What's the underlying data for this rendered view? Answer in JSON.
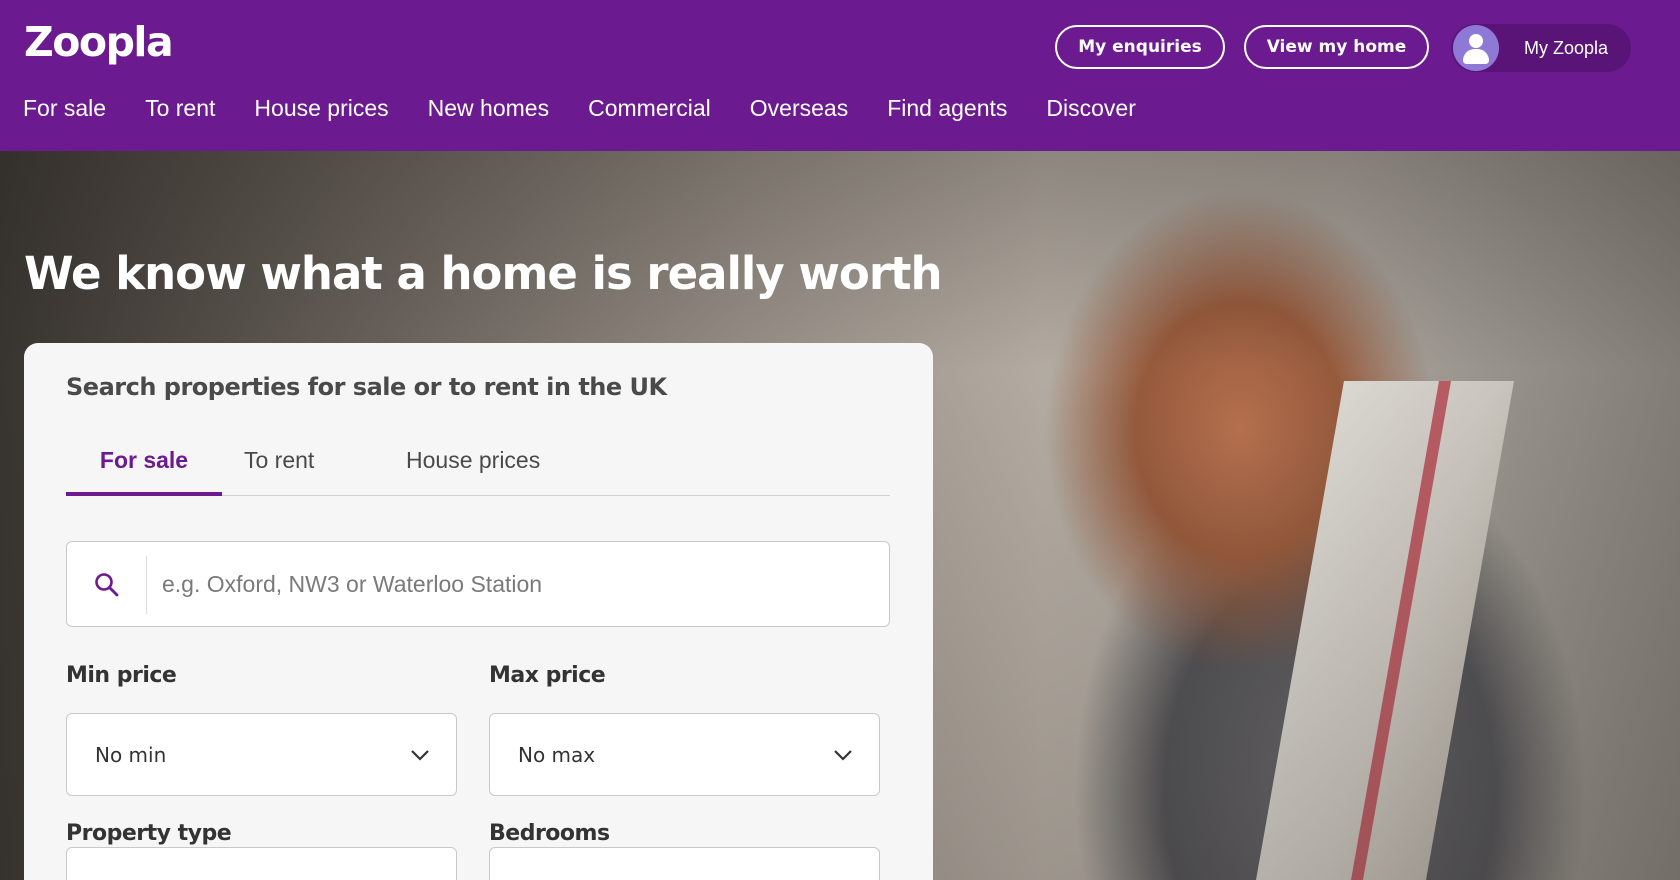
{
  "header": {
    "logo": "Zoopla",
    "my_enquiries": "My enquiries",
    "view_my_home": "View my home",
    "my_zoopla": "My Zoopla",
    "nav": [
      "For sale",
      "To rent",
      "House prices",
      "New homes",
      "Commercial",
      "Overseas",
      "Find agents",
      "Discover"
    ],
    "background_color": "#6b1b8f"
  },
  "hero": {
    "title": "We know what a home is really worth"
  },
  "search_card": {
    "title": "Search properties for sale or to rent in the UK",
    "tabs": [
      {
        "label": "For sale",
        "active": true
      },
      {
        "label": "To rent",
        "active": false
      },
      {
        "label": "House prices",
        "active": false
      }
    ],
    "search": {
      "placeholder": "e.g. Oxford, NW3 or Waterloo Station",
      "value": ""
    },
    "min_price": {
      "label": "Min price",
      "value": "No min"
    },
    "max_price": {
      "label": "Max price",
      "value": "No max"
    },
    "property_type": {
      "label": "Property type"
    },
    "bedrooms": {
      "label": "Bedrooms"
    },
    "accent_color": "#6b1b8f"
  }
}
